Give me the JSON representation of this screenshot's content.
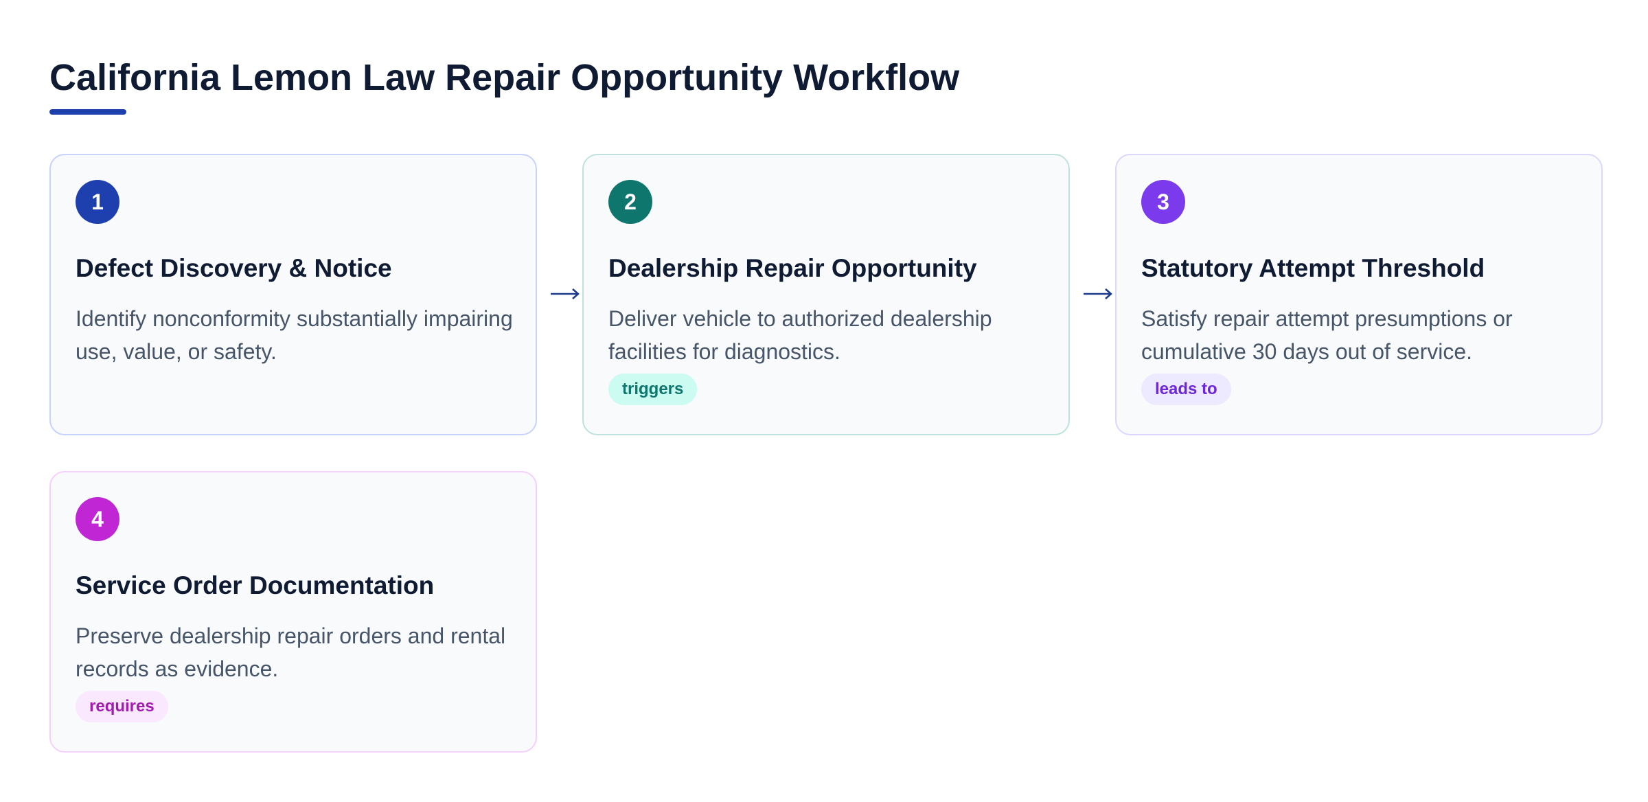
{
  "title": "California Lemon Law Repair Opportunity Workflow",
  "colors": {
    "title_accent": "#1e40af",
    "connector": "#1e3a8a"
  },
  "steps": [
    {
      "number": "1",
      "title": "Defect Discovery & Notice",
      "description": "Identify nonconformity substantially impairing use, value, or safety.",
      "tag": "",
      "color": "#1e40af"
    },
    {
      "number": "2",
      "title": "Dealership Repair Opportunity",
      "description": "Deliver vehicle to authorized dealership facilities for diagnostics.",
      "tag": "triggers",
      "color": "#0f766e",
      "tag_bg": "#ccfbf1",
      "tag_fg": "#0f766e"
    },
    {
      "number": "3",
      "title": "Statutory Attempt Threshold",
      "description": "Satisfy repair attempt presumptions or cumulative 30 days out of service.",
      "tag": "leads to",
      "color": "#7c3aed",
      "tag_bg": "#ede9fe",
      "tag_fg": "#6d28d9"
    },
    {
      "number": "4",
      "title": "Service Order Documentation",
      "description": "Preserve dealership repair orders and rental records as evidence.",
      "tag": "requires",
      "color": "#c026d3",
      "tag_bg": "#fae8ff",
      "tag_fg": "#a21caf"
    }
  ],
  "connectors": [
    {
      "from": "1",
      "to": "2",
      "icon": "right-arrow-icon"
    },
    {
      "from": "2",
      "to": "3",
      "icon": "right-arrow-icon"
    }
  ]
}
